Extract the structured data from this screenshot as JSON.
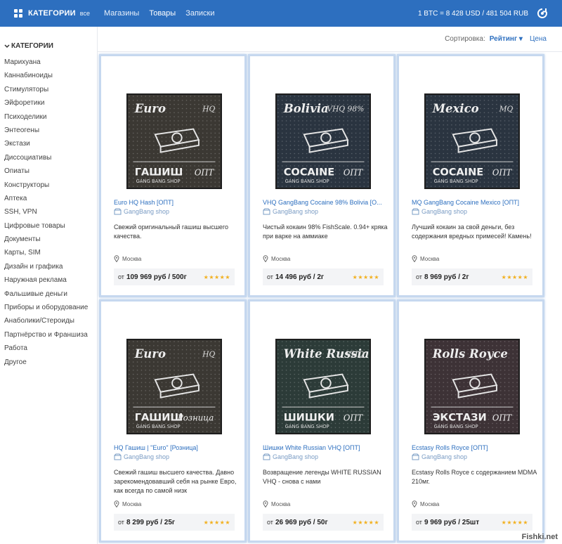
{
  "header": {
    "categories_label": "КАТЕГОРИИ",
    "all_label": "все",
    "nav": [
      "Магазины",
      "Товары",
      "Записки"
    ],
    "rate": "1 BTC = 8 428 USD / 481 504 RUB"
  },
  "sidebar": {
    "title": "КАТЕГОРИИ",
    "items": [
      "Марихуана",
      "Каннабиноиды",
      "Стимуляторы",
      "Эйфоретики",
      "Психоделики",
      "Энтеогены",
      "Экстази",
      "Диссоциативы",
      "Опиаты",
      "Конструкторы",
      "Аптека",
      "SSH, VPN",
      "Цифровые товары",
      "Документы",
      "Карты, SIM",
      "Дизайн и графика",
      "Наружная реклама",
      "Фальшивые деньги",
      "Приборы и оборудование",
      "Анаболики/Стероиды",
      "Партнёрство и Франшиза",
      "Работа",
      "Другое"
    ]
  },
  "sort": {
    "label": "Сортировка:",
    "active": "Рейтинг",
    "other": "Цена"
  },
  "products": [
    {
      "title": "Euro HQ Hash [ОПТ]",
      "shop": "GangBang shop",
      "desc": "Свежий оригинальный гашиш высшего качества.",
      "location": "Москва",
      "price_from": "от",
      "price": "109 969 руб / 500г",
      "stars": "★★★★★",
      "art_top": "Euro",
      "art_top2": "HQ",
      "art_bottom": "ГАШИШ",
      "art_tag": "ОПТ",
      "art_sub": "GANG BANG SHOP",
      "art_bg": "#3b3833"
    },
    {
      "title": "VHQ GangBang Cocaine 98% Bolivia [О...",
      "shop": "GangBang shop",
      "desc": "Чистый кокаин 98% FishScale. 0.94+ кряка при варке на аммиаке",
      "location": "Москва",
      "price_from": "от",
      "price": "14 496 руб / 2г",
      "stars": "★★★★★",
      "art_top": "Bolivia",
      "art_top2": "VHQ 98%",
      "art_bottom": "COCAINE",
      "art_tag": "ОПТ",
      "art_sub": "GANG BANG SHOP",
      "art_bg": "#2a3440"
    },
    {
      "title": "MQ GangBang Cocaine Mexico [ОПТ]",
      "shop": "GangBang shop",
      "desc": "Лучший кокаин за свой деньги, без содержания вредных примесей! Камень!",
      "location": "Москва",
      "price_from": "от",
      "price": "8 969 руб / 2г",
      "stars": "★★★★★",
      "art_top": "Mexico",
      "art_top2": "MQ",
      "art_bottom": "COCAINE",
      "art_tag": "ОПТ",
      "art_sub": "GANG BANG SHOP",
      "art_bg": "#2a3440"
    },
    {
      "title": "HQ Гашиш | \"Euro\" [Розница]",
      "shop": "GangBang shop",
      "desc": "Свежий гашиш высшего качества. Давно зарекомендовавший себя на рынке Евро, как всегда по самой низк",
      "location": "Москва",
      "price_from": "от",
      "price": "8 299 руб / 25г",
      "stars": "★★★★★",
      "art_top": "Euro",
      "art_top2": "HQ",
      "art_bottom": "ГАШИШ",
      "art_tag": "Розница",
      "art_sub": "GANG BANG SHOP",
      "art_bg": "#3b3833"
    },
    {
      "title": "Шишки White Russian VHQ [ОПТ]",
      "shop": "GangBang shop",
      "desc": "Возвращение легенды WHITE RUSSIAN VHQ - снова с нами",
      "location": "Москва",
      "price_from": "от",
      "price": "26 969 руб / 50г",
      "stars": "★★★★★",
      "art_top": "White Russian",
      "art_top2": "VHQ",
      "art_bottom": "ШИШКИ",
      "art_tag": "ОПТ",
      "art_sub": "GANG BANG SHOP",
      "art_bg": "#2c3b38"
    },
    {
      "title": "Ecstasy Rolls Royce [ОПТ]",
      "shop": "GangBang shop",
      "desc": "Ecstasy Rolls Royce с содержанием MDMA 210мг.",
      "location": "Москва",
      "price_from": "от",
      "price": "9 969 руб / 25шт",
      "stars": "★★★★★",
      "art_top": "Rolls Royce",
      "art_top2": "",
      "art_bottom": "ЭКСТАЗИ",
      "art_tag": "ОПТ",
      "art_sub": "GANG BANG SHOP",
      "art_bg": "#3d3236"
    }
  ],
  "watermark": "Fishki.net",
  "colors": {
    "brand": "#2d6fbf",
    "star": "#f2b01e",
    "card_border": "#c6d8ef"
  }
}
